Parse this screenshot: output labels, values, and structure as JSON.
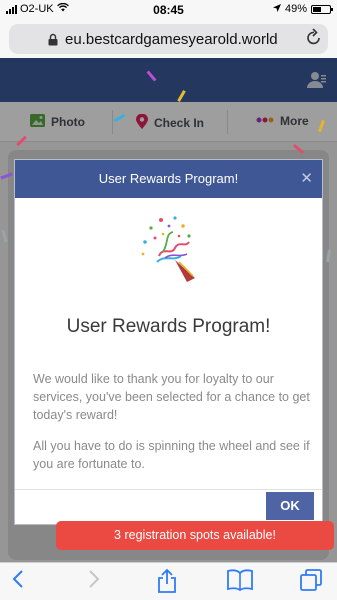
{
  "status": {
    "carrier": "O2-UK",
    "time": "08:45",
    "battery": "49%"
  },
  "browser": {
    "url": "eu.bestcardgamesyearold.world"
  },
  "page": {
    "actions": [
      {
        "label": "Photo"
      },
      {
        "label": "Check In"
      },
      {
        "label": "More"
      }
    ]
  },
  "modal": {
    "header_title": "User Rewards Program!",
    "close_label": "✕",
    "title": "User Rewards Program!",
    "paragraph1": "We would like to thank you for loyalty to our services, you've been selected for a chance to get today's reward!",
    "paragraph2": "All you have to do is spinning the wheel and see if you are fortunate to.",
    "ok_label": "OK"
  },
  "toast": {
    "text": "3 registration spots available!"
  },
  "colors": {
    "header_blue": "#3f5794",
    "toast_red": "#ea4a42",
    "ios_blue": "#2e7cf6"
  },
  "icons": [
    "back-icon",
    "forward-icon",
    "share-icon",
    "bookmarks-icon",
    "tabs-icon",
    "party-popper-icon"
  ]
}
